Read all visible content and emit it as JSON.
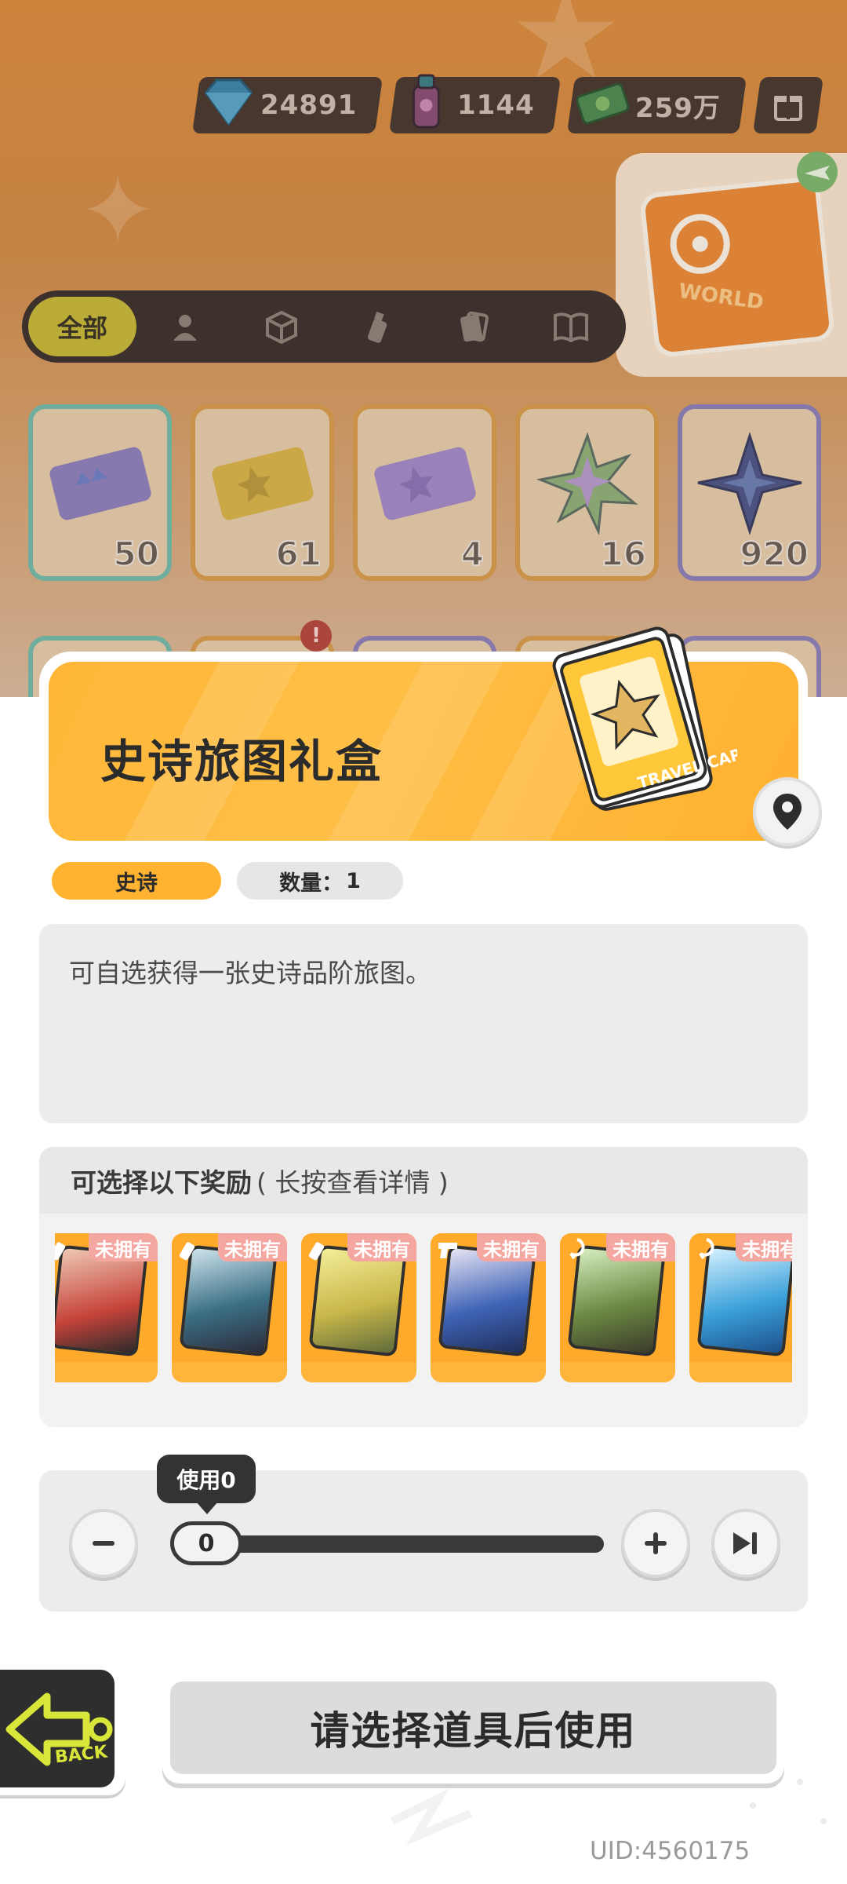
{
  "topbar": {
    "currencies": [
      {
        "icon": "diamond-icon",
        "value": "24891"
      },
      {
        "icon": "spray-can-icon",
        "value": "1144"
      },
      {
        "icon": "cash-icon",
        "value": "259万"
      }
    ],
    "gift_icon": "gift-box-icon"
  },
  "world_card": {
    "label": "WORLD"
  },
  "filters": {
    "tabs": [
      {
        "label": "全部",
        "icon": "",
        "active": true
      },
      {
        "label": "",
        "icon": "person-icon"
      },
      {
        "label": "",
        "icon": "cube-icon"
      },
      {
        "label": "",
        "icon": "spray-paint-icon"
      },
      {
        "label": "",
        "icon": "card-stack-icon"
      },
      {
        "label": "",
        "icon": "book-icon"
      }
    ]
  },
  "inventory": {
    "items": [
      {
        "name": "ticket-crown",
        "count": "50",
        "color": "#74b8a7"
      },
      {
        "name": "ticket-star-gold",
        "count": "61",
        "color": "#d59a4c"
      },
      {
        "name": "ticket-star-purple",
        "count": "4",
        "color": "#d59a4c"
      },
      {
        "name": "rainbow-star",
        "count": "16",
        "color": "#d59a4c"
      },
      {
        "name": "dark-star",
        "count": "920",
        "color": "#8c7fb5"
      }
    ],
    "notice_badge": "!"
  },
  "detail": {
    "title": "史诗旅图礼盒",
    "card_label": "TRAVEL CARD",
    "rarity": "史诗",
    "quantity_label": "数量：",
    "quantity_value": "1",
    "description": "可自选获得一张史诗品阶旅图。",
    "accent": "#ffb636"
  },
  "rewards": {
    "heading": "可选择以下奖励",
    "hint": "( 长按查看详情 )",
    "not_owned": "未拥有",
    "cards": [
      {
        "type_icon": "spray-icon",
        "tone": "#c6433a"
      },
      {
        "type_icon": "spray-icon",
        "tone": "#3b6f84"
      },
      {
        "type_icon": "spray-icon",
        "tone": "#c9b84a"
      },
      {
        "type_icon": "pistol-icon",
        "tone": "#3f64b6"
      },
      {
        "type_icon": "swirl-icon",
        "tone": "#6d8a43"
      },
      {
        "type_icon": "swirl-icon",
        "tone": "#3aa0d9"
      }
    ]
  },
  "usage": {
    "tooltip": "使用0",
    "value": "0",
    "fraction": 0
  },
  "bottom": {
    "back_label": "BACK",
    "action_label": "请选择道具后使用",
    "uid": "UID:4560175"
  }
}
